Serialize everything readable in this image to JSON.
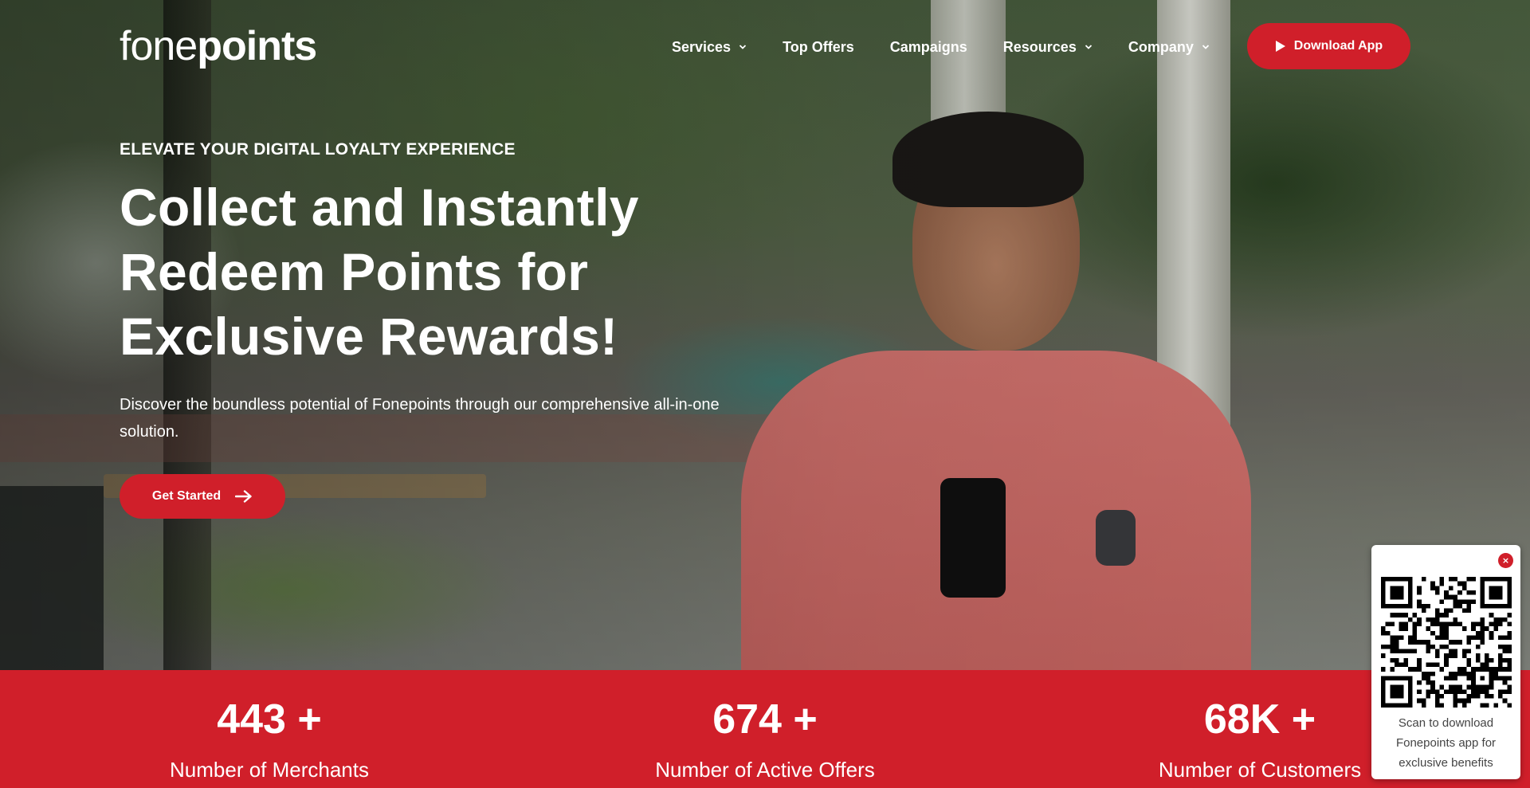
{
  "brand": {
    "logo_part1": "fone",
    "logo_part2": "points"
  },
  "nav": {
    "items": [
      {
        "label": "Services",
        "has_dropdown": true
      },
      {
        "label": "Top Offers",
        "has_dropdown": false
      },
      {
        "label": "Campaigns",
        "has_dropdown": false
      },
      {
        "label": "Resources",
        "has_dropdown": true
      },
      {
        "label": "Company",
        "has_dropdown": true
      }
    ],
    "download_label": "Download App",
    "download_icon": "play-icon"
  },
  "hero": {
    "eyebrow": "ELEVATE YOUR DIGITAL LOYALTY EXPERIENCE",
    "headline_line1": "Collect and Instantly",
    "headline_line2": "Redeem Points for",
    "headline_line3": "Exclusive Rewards!",
    "description": "Discover the boundless potential of Fonepoints through our comprehensive all-in-one solution.",
    "cta_label": "Get Started",
    "cta_icon": "arrow-right-icon"
  },
  "stats": [
    {
      "value": "443 +",
      "label": "Number of Merchants"
    },
    {
      "value": "674 +",
      "label": "Number of Active Offers"
    },
    {
      "value": "68K +",
      "label": "Number of Customers"
    }
  ],
  "qr_popup": {
    "close_icon": "close-icon",
    "close_glyph": "×",
    "caption": "Scan to download Fonepoints app for exclusive benefits"
  },
  "colors": {
    "accent": "#d01f2a",
    "text_on_dark": "#ffffff"
  }
}
